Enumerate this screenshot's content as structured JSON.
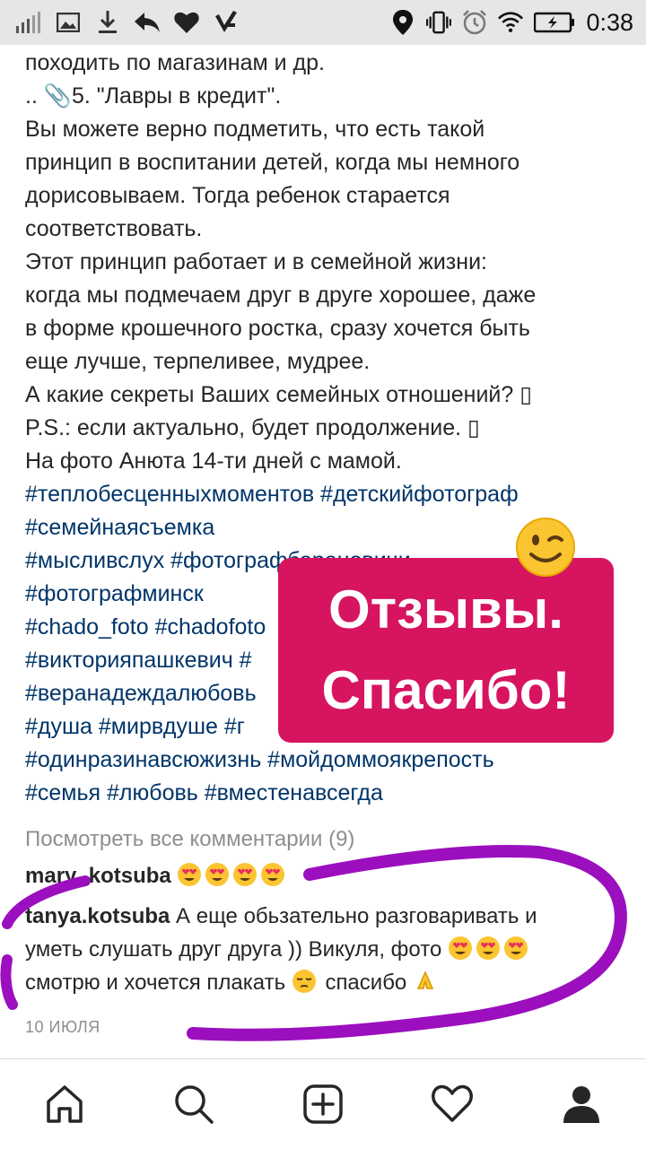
{
  "status_bar": {
    "time": "0:38",
    "left_icons": [
      "signal-icon",
      "image-icon",
      "download-icon",
      "reply-icon",
      "heart-icon",
      "check-icon"
    ],
    "right_icons": [
      "location-icon",
      "vibrate-icon",
      "alarm-icon",
      "wifi-icon",
      "battery-icon"
    ]
  },
  "post": {
    "lines": [
      {
        "text": "походить по магазинам и др.",
        "type": "text"
      },
      {
        "text": ".. 📎5. \"Лавры в кредит\".",
        "type": "text"
      },
      {
        "text": "Вы можете верно подметить, что есть такой",
        "type": "text"
      },
      {
        "text": "принцип в воспитании детей, когда мы немного",
        "type": "text"
      },
      {
        "text": "дорисовываем. Тогда ребенок старается",
        "type": "text"
      },
      {
        "text": "соответствовать.",
        "type": "text"
      },
      {
        "text": "Этот принцип работает и в семейной жизни:",
        "type": "text"
      },
      {
        "text": "когда мы подмечаем друг в друге хорошее, даже",
        "type": "text"
      },
      {
        "text": "в форме крошечного ростка, сразу хочется быть",
        "type": "text"
      },
      {
        "text": "еще лучше, терпеливее, мудрее.",
        "type": "text"
      },
      {
        "text": "А какие секреты Ваших семейных отношений? ▯",
        "type": "text"
      },
      {
        "text": "P.S.: если актуально, будет продолжение. ▯",
        "type": "text"
      },
      {
        "text": "На фото Анюта 14-ти дней с мамой.",
        "type": "text"
      },
      {
        "text": "#теплобесценныхмоментов #детскийфотограф",
        "type": "tag"
      },
      {
        "text": "#семейнаясъемка",
        "type": "tag"
      },
      {
        "text": "#мысливслух #фотографбарановичи",
        "type": "tag"
      },
      {
        "text": "#фотографминск",
        "type": "tag"
      },
      {
        "text": "#chado_foto #chadofoto",
        "type": "tag"
      },
      {
        "text": "#викторияпашкевич #",
        "type": "tag"
      },
      {
        "text": "#веранадеждалюбовь",
        "type": "tag"
      },
      {
        "text": "#душа #мирвдуше #г",
        "type": "tag"
      },
      {
        "text": "#одинразинавсюжизнь #мойдоммоякрепость",
        "type": "tag"
      },
      {
        "text": "#семья #любовь #вместенавсегда",
        "type": "tag"
      }
    ]
  },
  "sticker": {
    "line1": "Отзывы.",
    "line2": "Спасибо!",
    "background": "#d6145f",
    "emoji": "winking-face-icon"
  },
  "comments": {
    "view_all": "Посмотреть все комментарии (9)",
    "items": [
      {
        "user": "mary_kotsuba",
        "text": " ",
        "emoji_count": 4
      },
      {
        "user": "tanya.kotsuba",
        "line1": " А еще обьзательно разговаривать и",
        "line2": "уметь слушать друг друга )) Викуля, фото",
        "line3a": "смотрю и хочется плакать",
        "line3b": "спасибо"
      }
    ],
    "date": "10 ИЮЛЯ"
  },
  "scribble_color": "#9b0fbf",
  "bottom_nav": {
    "items": [
      "home-icon",
      "search-icon",
      "new-post-icon",
      "activity-heart-icon",
      "profile-icon"
    ]
  }
}
